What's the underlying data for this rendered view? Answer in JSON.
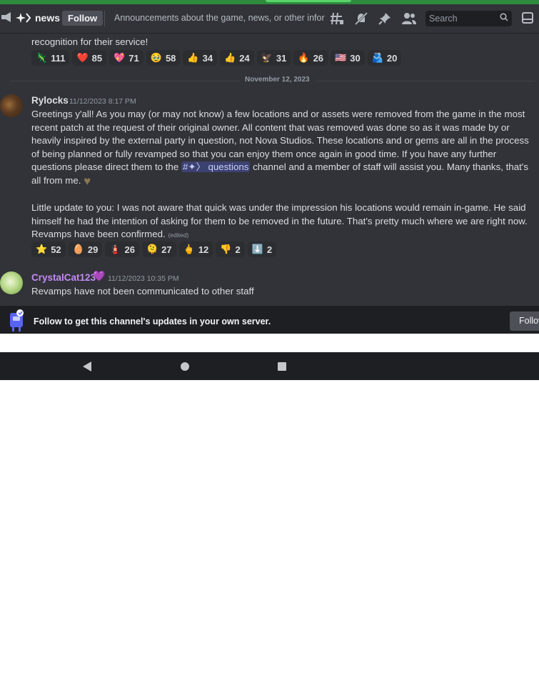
{
  "header": {
    "channel_name": "news",
    "follow_label": "Follow",
    "topic": "Announcements about the game, news, or other informa...",
    "search_placeholder": "Search"
  },
  "top_message": {
    "tail_text": "recognition for their service!",
    "reactions": [
      {
        "emoji": "🦎",
        "count": "111"
      },
      {
        "emoji": "❤️",
        "count": "85"
      },
      {
        "emoji": "💖",
        "count": "71"
      },
      {
        "emoji": "🥹",
        "count": "58"
      },
      {
        "emoji": "👍",
        "count": "34"
      },
      {
        "emoji": "👍",
        "count": "24"
      },
      {
        "emoji": "🦅",
        "count": "31"
      },
      {
        "emoji": "🔥",
        "count": "26"
      },
      {
        "emoji": "🇺🇸",
        "count": "30"
      },
      {
        "emoji": "🫂",
        "count": "20"
      }
    ]
  },
  "date_divider": "November 12, 2023",
  "message_rylocks": {
    "author": "Rylocks",
    "author_color": "#f2f3f5",
    "timestamp": "11/12/2023 8:17 PM",
    "para1_before_mention": "Greetings y'all! As you may (or may not know) a few locations and or assets were removed from the game in the most recent patch at the request of their original owner. All content that was removed was done so as it was made by or heavily inspired by the external party in question, not Nova Studios. These locations and or gems are all in the process of being planned or fully revamped so that you can enjoy them once again in good time. If you have any further questions please direct them to the",
    "mention": "#✦〉 questions",
    "para1_after_mention": "channel and a member of staff will assist you. Many thanks, that's all from me.",
    "para2": "Little update to you: I was not aware that quick was under the impression his locations would remain in-game. He said himself he had the intention of asking for them to be removed in the future. That's pretty much where we are right now. Revamps have been confirmed.",
    "edited": "(edited)",
    "reactions": [
      {
        "emoji": "⭐",
        "count": "52"
      },
      {
        "emoji": "🥚",
        "count": "29"
      },
      {
        "emoji": "🧯",
        "count": "26"
      },
      {
        "emoji": "🫠",
        "count": "27"
      },
      {
        "emoji": "🖕",
        "count": "12"
      },
      {
        "emoji": "👎",
        "count": "2"
      },
      {
        "emoji": "⬇️",
        "count": "2"
      }
    ]
  },
  "message_crystal": {
    "author": "CrystalCat123",
    "author_badge": "💜",
    "author_color": "#c28cf2",
    "timestamp": "11/12/2023 10:35 PM",
    "text": "Revamps have not been communicated to other staff"
  },
  "follow_banner": {
    "text": "Follow to get this channel's updates in your own server.",
    "button_label": "Follow"
  }
}
